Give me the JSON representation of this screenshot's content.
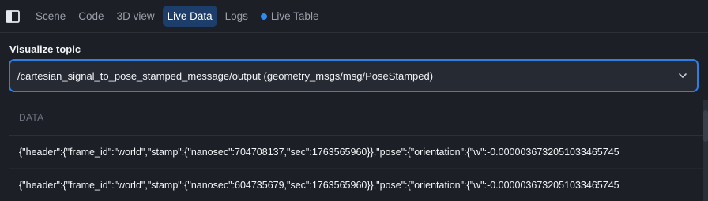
{
  "colors": {
    "background": "#1c1f26",
    "active_tab_bg": "#1d3e6b",
    "accent": "#2e7fe0",
    "live_dot": "#2d8cf0"
  },
  "tabbar": {
    "toggle_icon": "sidebar-toggle-icon",
    "tabs": [
      {
        "label": "Scene"
      },
      {
        "label": "Code"
      },
      {
        "label": "3D view"
      },
      {
        "label": "Live Data"
      },
      {
        "label": "Logs"
      },
      {
        "label": "Live Table"
      }
    ],
    "active_index": 3
  },
  "visualize": {
    "label": "Visualize topic",
    "selected_topic": "/cartesian_signal_to_pose_stamped_message/output (geometry_msgs/msg/PoseStamped)",
    "chevron_icon": "chevron-down-icon"
  },
  "table": {
    "column_header": "DATA",
    "rows": [
      "{\"header\":{\"frame_id\":\"world\",\"stamp\":{\"nanosec\":704708137,\"sec\":1763565960}},\"pose\":{\"orientation\":{\"w\":-0.0000036732051033465745",
      "{\"header\":{\"frame_id\":\"world\",\"stamp\":{\"nanosec\":604735679,\"sec\":1763565960}},\"pose\":{\"orientation\":{\"w\":-0.0000036732051033465745"
    ]
  }
}
